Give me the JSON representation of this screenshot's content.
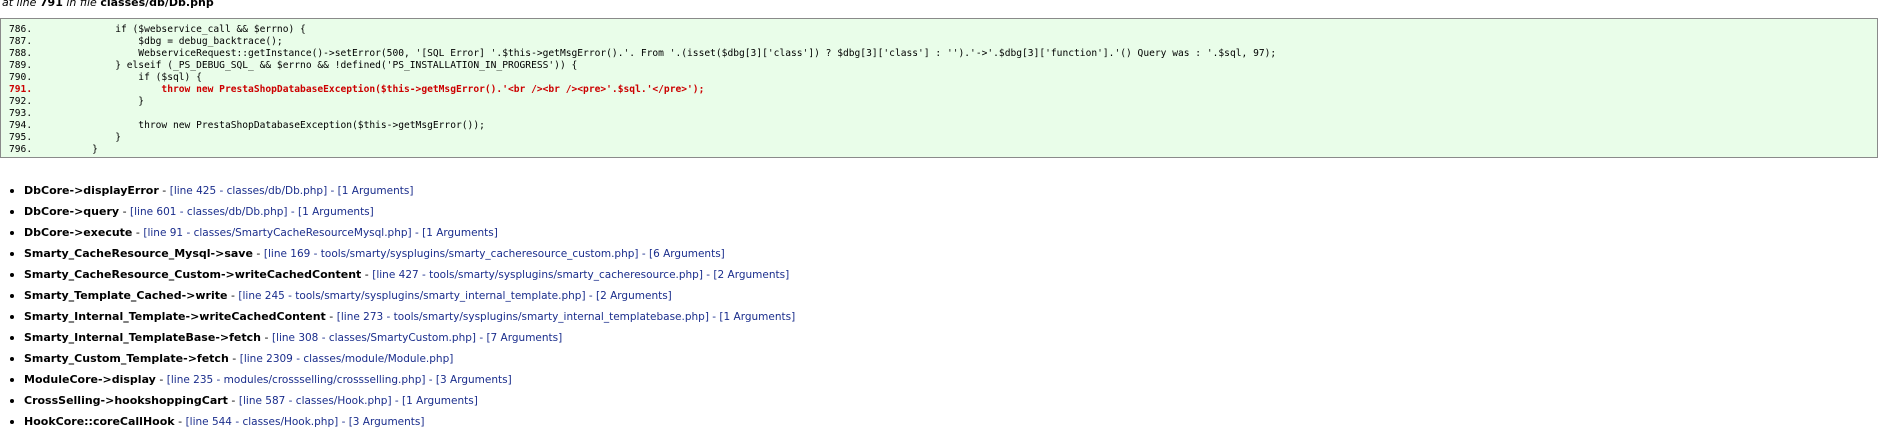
{
  "header": {
    "prefix": "at line ",
    "line": "791",
    "mid": " in file ",
    "file": "classes/db/Db.php"
  },
  "code_lines": [
    {
      "num": "786.",
      "text": "        if ($webservice_call && $errno) {"
    },
    {
      "num": "787.",
      "text": "            $dbg = debug_backtrace();"
    },
    {
      "num": "788.",
      "text": "            WebserviceRequest::getInstance()->setError(500, '[SQL Error] '.$this->getMsgError().'. From '.(isset($dbg[3]['class']) ? $dbg[3]['class'] : '').'->'.$dbg[3]['function'].'() Query was : '.$sql, 97);"
    },
    {
      "num": "789.",
      "text": "        } elseif (_PS_DEBUG_SQL_ && $errno && !defined('PS_INSTALLATION_IN_PROGRESS')) {"
    },
    {
      "num": "790.",
      "text": "            if ($sql) {"
    },
    {
      "num": "791.",
      "text": "                throw new PrestaShopDatabaseException($this->getMsgError().'<br /><br /><pre>'.$sql.'</pre>');",
      "highlight": true
    },
    {
      "num": "792.",
      "text": "            }"
    },
    {
      "num": "793.",
      "text": ""
    },
    {
      "num": "794.",
      "text": "            throw new PrestaShopDatabaseException($this->getMsgError());"
    },
    {
      "num": "795.",
      "text": "        }"
    },
    {
      "num": "796.",
      "text": "    }"
    }
  ],
  "trace": [
    {
      "fn": "DbCore->displayError",
      "info": "[line 425 - classes/db/Db.php] - [1 Arguments]"
    },
    {
      "fn": "DbCore->query",
      "info": "[line 601 - classes/db/Db.php] - [1 Arguments]"
    },
    {
      "fn": "DbCore->execute",
      "info": "[line 91 - classes/SmartyCacheResourceMysql.php] - [1 Arguments]"
    },
    {
      "fn": "Smarty_CacheResource_Mysql->save",
      "info": "[line 169 - tools/smarty/sysplugins/smarty_cacheresource_custom.php] - [6 Arguments]"
    },
    {
      "fn": "Smarty_CacheResource_Custom->writeCachedContent",
      "info": "[line 427 - tools/smarty/sysplugins/smarty_cacheresource.php] - [2 Arguments]"
    },
    {
      "fn": "Smarty_Template_Cached->write",
      "info": "[line 245 - tools/smarty/sysplugins/smarty_internal_template.php] - [2 Arguments]"
    },
    {
      "fn": "Smarty_Internal_Template->writeCachedContent",
      "info": "[line 273 - tools/smarty/sysplugins/smarty_internal_templatebase.php] - [1 Arguments]"
    },
    {
      "fn": "Smarty_Internal_TemplateBase->fetch",
      "info": "[line 308 - classes/SmartyCustom.php] - [7 Arguments]"
    },
    {
      "fn": "Smarty_Custom_Template->fetch",
      "info": "[line 2309 - classes/module/Module.php]"
    },
    {
      "fn": "ModuleCore->display",
      "info": "[line 235 - modules/crossselling/crossselling.php] - [3 Arguments]"
    },
    {
      "fn": "CrossSelling->hookshoppingCart",
      "info": "[line 587 - classes/Hook.php] - [1 Arguments]"
    },
    {
      "fn": "HookCore::coreCallHook",
      "info": "[line 544 - classes/Hook.php] - [3 Arguments]"
    }
  ],
  "separator": " - "
}
